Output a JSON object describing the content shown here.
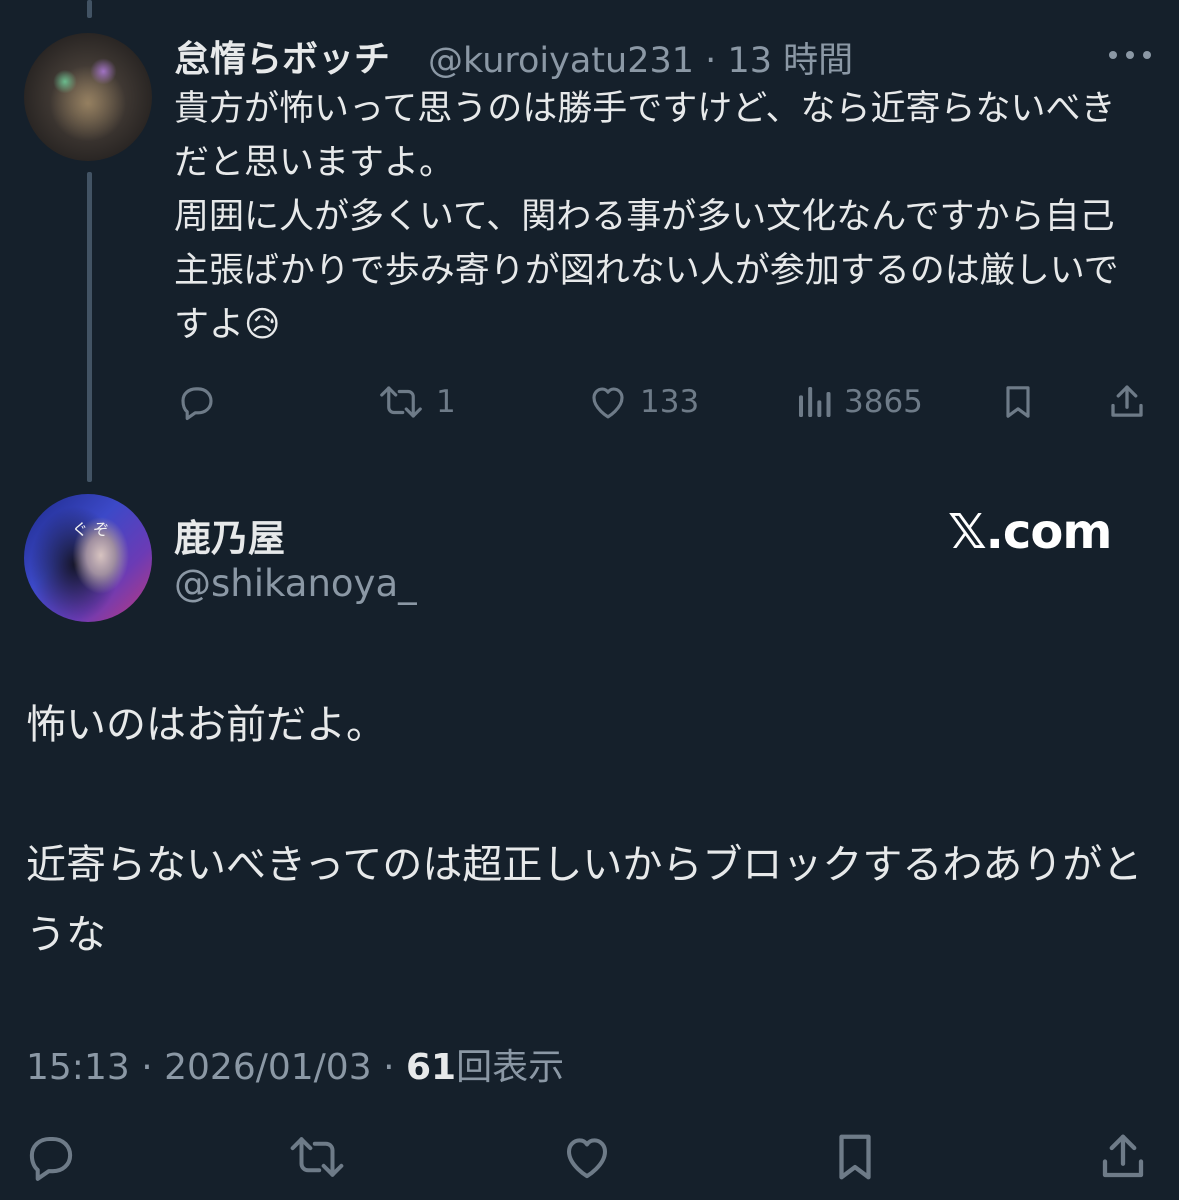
{
  "reply_tweet": {
    "display_name": "怠惰らボッチ",
    "handle": "@kuroiyatu231",
    "separator": "·",
    "time_ago": "13 時間",
    "body": "貴方が怖いって思うのは勝手ですけど、なら近寄らないべきだと思いますよ。\n周囲に人が多くいて、関わる事が多い文化なんですから自己主張ばかりで歩み寄りが図れない人が参加するのは厳しいですよ",
    "emoji": "😥",
    "actions": {
      "reply_count": "",
      "retweet_count": "1",
      "like_count": "133",
      "views_count": "3865"
    },
    "icons": [
      "comment-icon",
      "retweet-icon",
      "heart-icon",
      "views-icon",
      "bookmark-icon",
      "share-icon",
      "more-icon"
    ]
  },
  "main_tweet": {
    "display_name": "鹿乃屋",
    "handle": "@shikanoya_",
    "avatar_mark": "ぐ ぞ",
    "body": "怖いのはお前だよ。\n\n近寄らないべきってのは超正しいからブロックするわありがとうな",
    "time": "15:13",
    "separator": "·",
    "date": "2026/01/03",
    "views_number": "61",
    "views_label": "回表示"
  },
  "watermark": "𝕏.com",
  "colors": {
    "background": "#15202b",
    "text": "#e7e9ea",
    "secondary": "#8b98a5",
    "icon": "#6e7b88",
    "thread_line": "#425364"
  }
}
